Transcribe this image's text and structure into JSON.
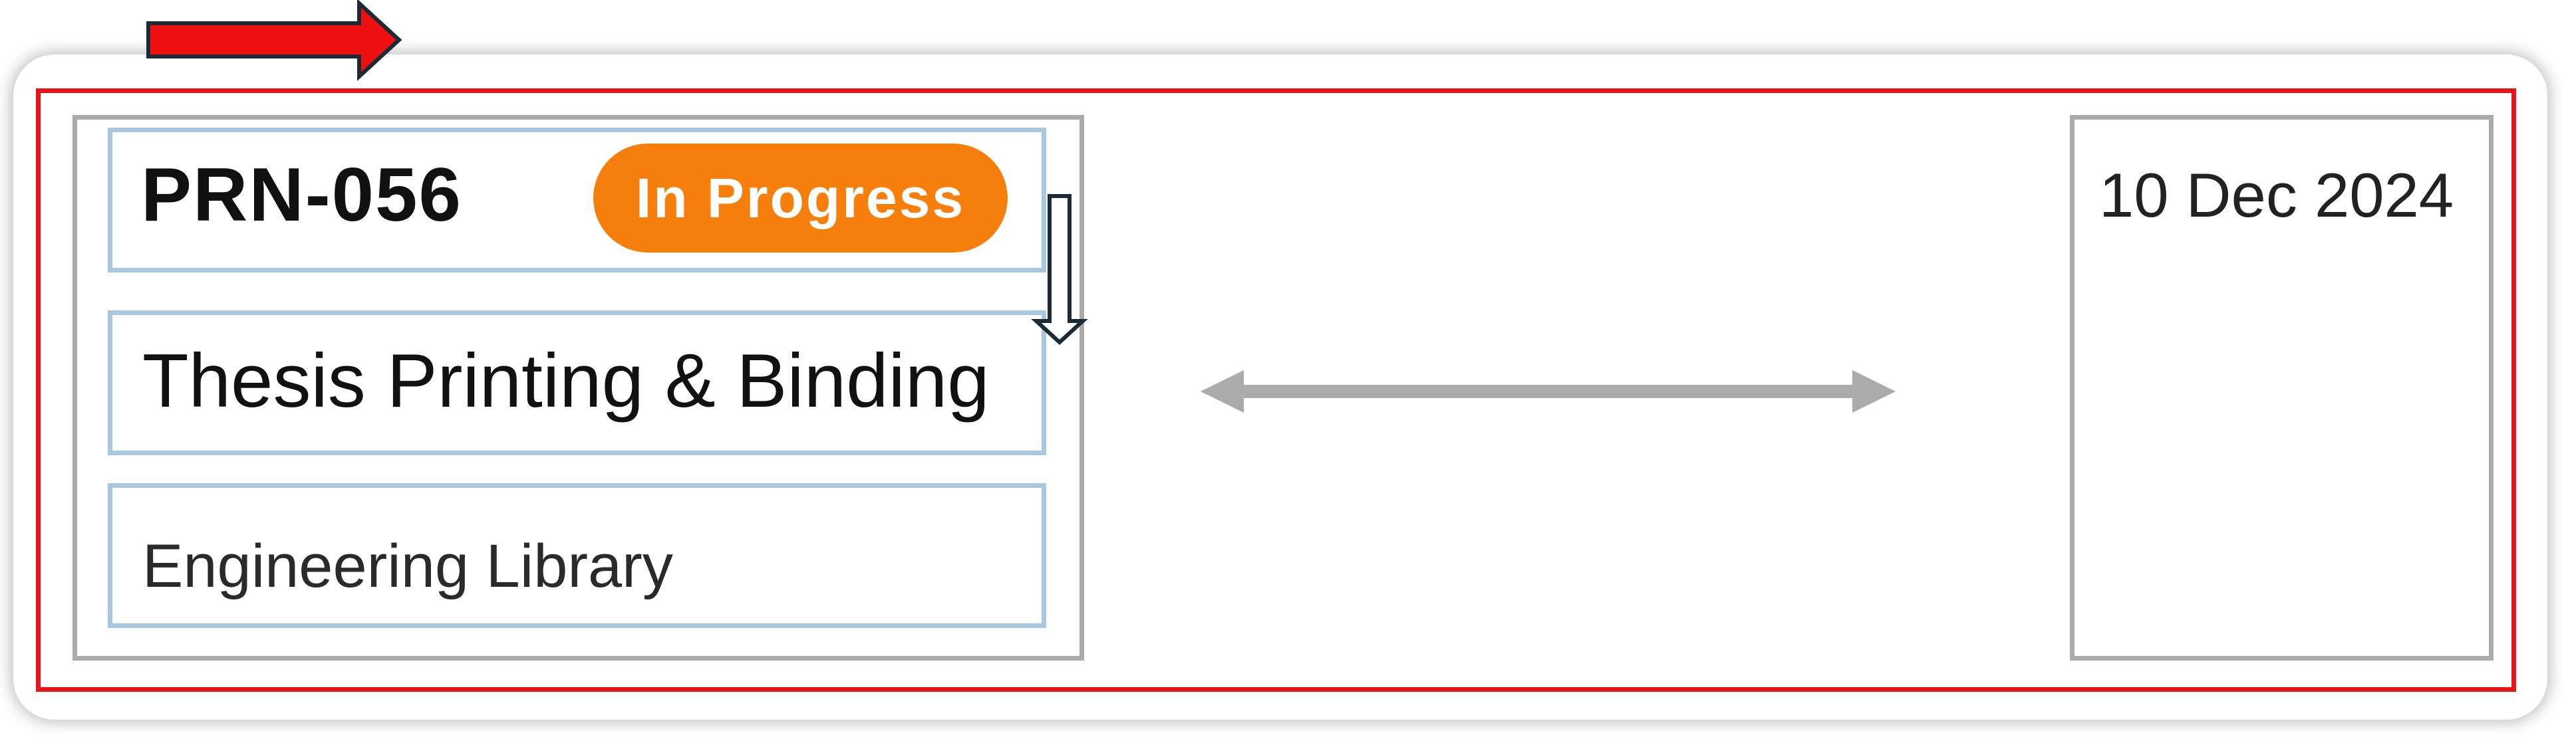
{
  "card": {
    "order_id": "PRN-056",
    "status": "In Progress",
    "item_name": "Thesis Printing & Binding",
    "location": "Engineering Library",
    "date": "10 Dec 2024"
  },
  "colors": {
    "status_badge": "#f57f0a",
    "highlight_frame": "#e8141a",
    "group_outline": "#ababab",
    "row_outline": "#a8c8e2",
    "spacing_arrow": "#ababab"
  },
  "icons": {
    "pointer_arrow": "right-arrow-icon",
    "flow_arrow": "down-arrow-icon",
    "spacing_arrow": "double-headed-arrow-icon"
  }
}
